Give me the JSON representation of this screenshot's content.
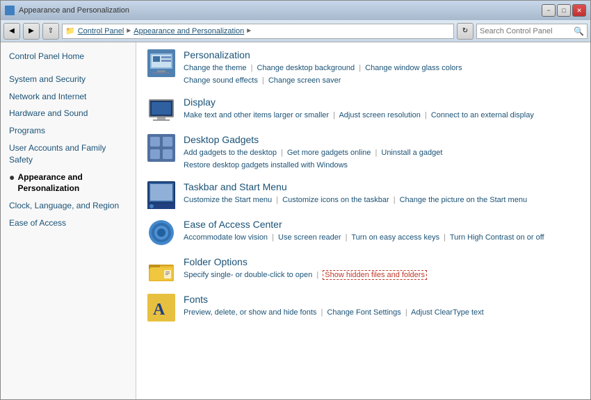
{
  "window": {
    "title": "Appearance and Personalization",
    "title_bar_icon": "folder-icon"
  },
  "address_bar": {
    "back_tooltip": "Back",
    "forward_tooltip": "Forward",
    "up_tooltip": "Up",
    "breadcrumb": [
      "Control Panel",
      "Appearance and Personalization"
    ],
    "search_placeholder": "Search Control Panel"
  },
  "sidebar": {
    "home_label": "Control Panel Home",
    "items": [
      {
        "id": "system-security",
        "label": "System and Security"
      },
      {
        "id": "network-internet",
        "label": "Network and Internet"
      },
      {
        "id": "hardware-sound",
        "label": "Hardware and Sound"
      },
      {
        "id": "programs",
        "label": "Programs"
      },
      {
        "id": "user-accounts",
        "label": "User Accounts and Family Safety"
      },
      {
        "id": "appearance",
        "label": "Appearance and Personalization",
        "active": true
      },
      {
        "id": "clock-language",
        "label": "Clock, Language, and Region"
      },
      {
        "id": "ease-access",
        "label": "Ease of Access"
      }
    ]
  },
  "sections": [
    {
      "id": "personalization",
      "title": "Personalization",
      "links_line1": [
        {
          "text": "Change the theme",
          "highlighted": false
        },
        {
          "text": "Change desktop background",
          "highlighted": false
        },
        {
          "text": "Change window glass colors",
          "highlighted": false
        }
      ],
      "links_line2": [
        {
          "text": "Change sound effects",
          "highlighted": false
        },
        {
          "text": "Change screen saver",
          "highlighted": false
        }
      ]
    },
    {
      "id": "display",
      "title": "Display",
      "links_line1": [
        {
          "text": "Make text and other items larger or smaller",
          "highlighted": false
        },
        {
          "text": "Adjust screen resolution",
          "highlighted": false
        },
        {
          "text": "Connect to an external display",
          "highlighted": false
        }
      ]
    },
    {
      "id": "desktop-gadgets",
      "title": "Desktop Gadgets",
      "links_line1": [
        {
          "text": "Add gadgets to the desktop",
          "highlighted": false
        },
        {
          "text": "Get more gadgets online",
          "highlighted": false
        },
        {
          "text": "Uninstall a gadget",
          "highlighted": false
        }
      ],
      "links_line2": [
        {
          "text": "Restore desktop gadgets installed with Windows",
          "highlighted": false
        }
      ]
    },
    {
      "id": "taskbar",
      "title": "Taskbar and Start Menu",
      "links_line1": [
        {
          "text": "Customize the Start menu",
          "highlighted": false
        },
        {
          "text": "Customize icons on the taskbar",
          "highlighted": false
        },
        {
          "text": "Change the picture on the Start menu",
          "highlighted": false
        }
      ]
    },
    {
      "id": "ease-center",
      "title": "Ease of Access Center",
      "links_line1": [
        {
          "text": "Accommodate low vision",
          "highlighted": false
        },
        {
          "text": "Use screen reader",
          "highlighted": false
        },
        {
          "text": "Turn on easy access keys",
          "highlighted": false
        },
        {
          "text": "Turn High Contrast on or off",
          "highlighted": false
        }
      ]
    },
    {
      "id": "folder-options",
      "title": "Folder Options",
      "links_line1": [
        {
          "text": "Specify single- or double-click to open",
          "highlighted": false
        },
        {
          "text": "Show hidden files and folders",
          "highlighted": true
        }
      ]
    },
    {
      "id": "fonts",
      "title": "Fonts",
      "links_line1": [
        {
          "text": "Preview, delete, or show and hide fonts",
          "highlighted": false
        },
        {
          "text": "Change Font Settings",
          "highlighted": false
        },
        {
          "text": "Adjust ClearType text",
          "highlighted": false
        }
      ]
    }
  ]
}
